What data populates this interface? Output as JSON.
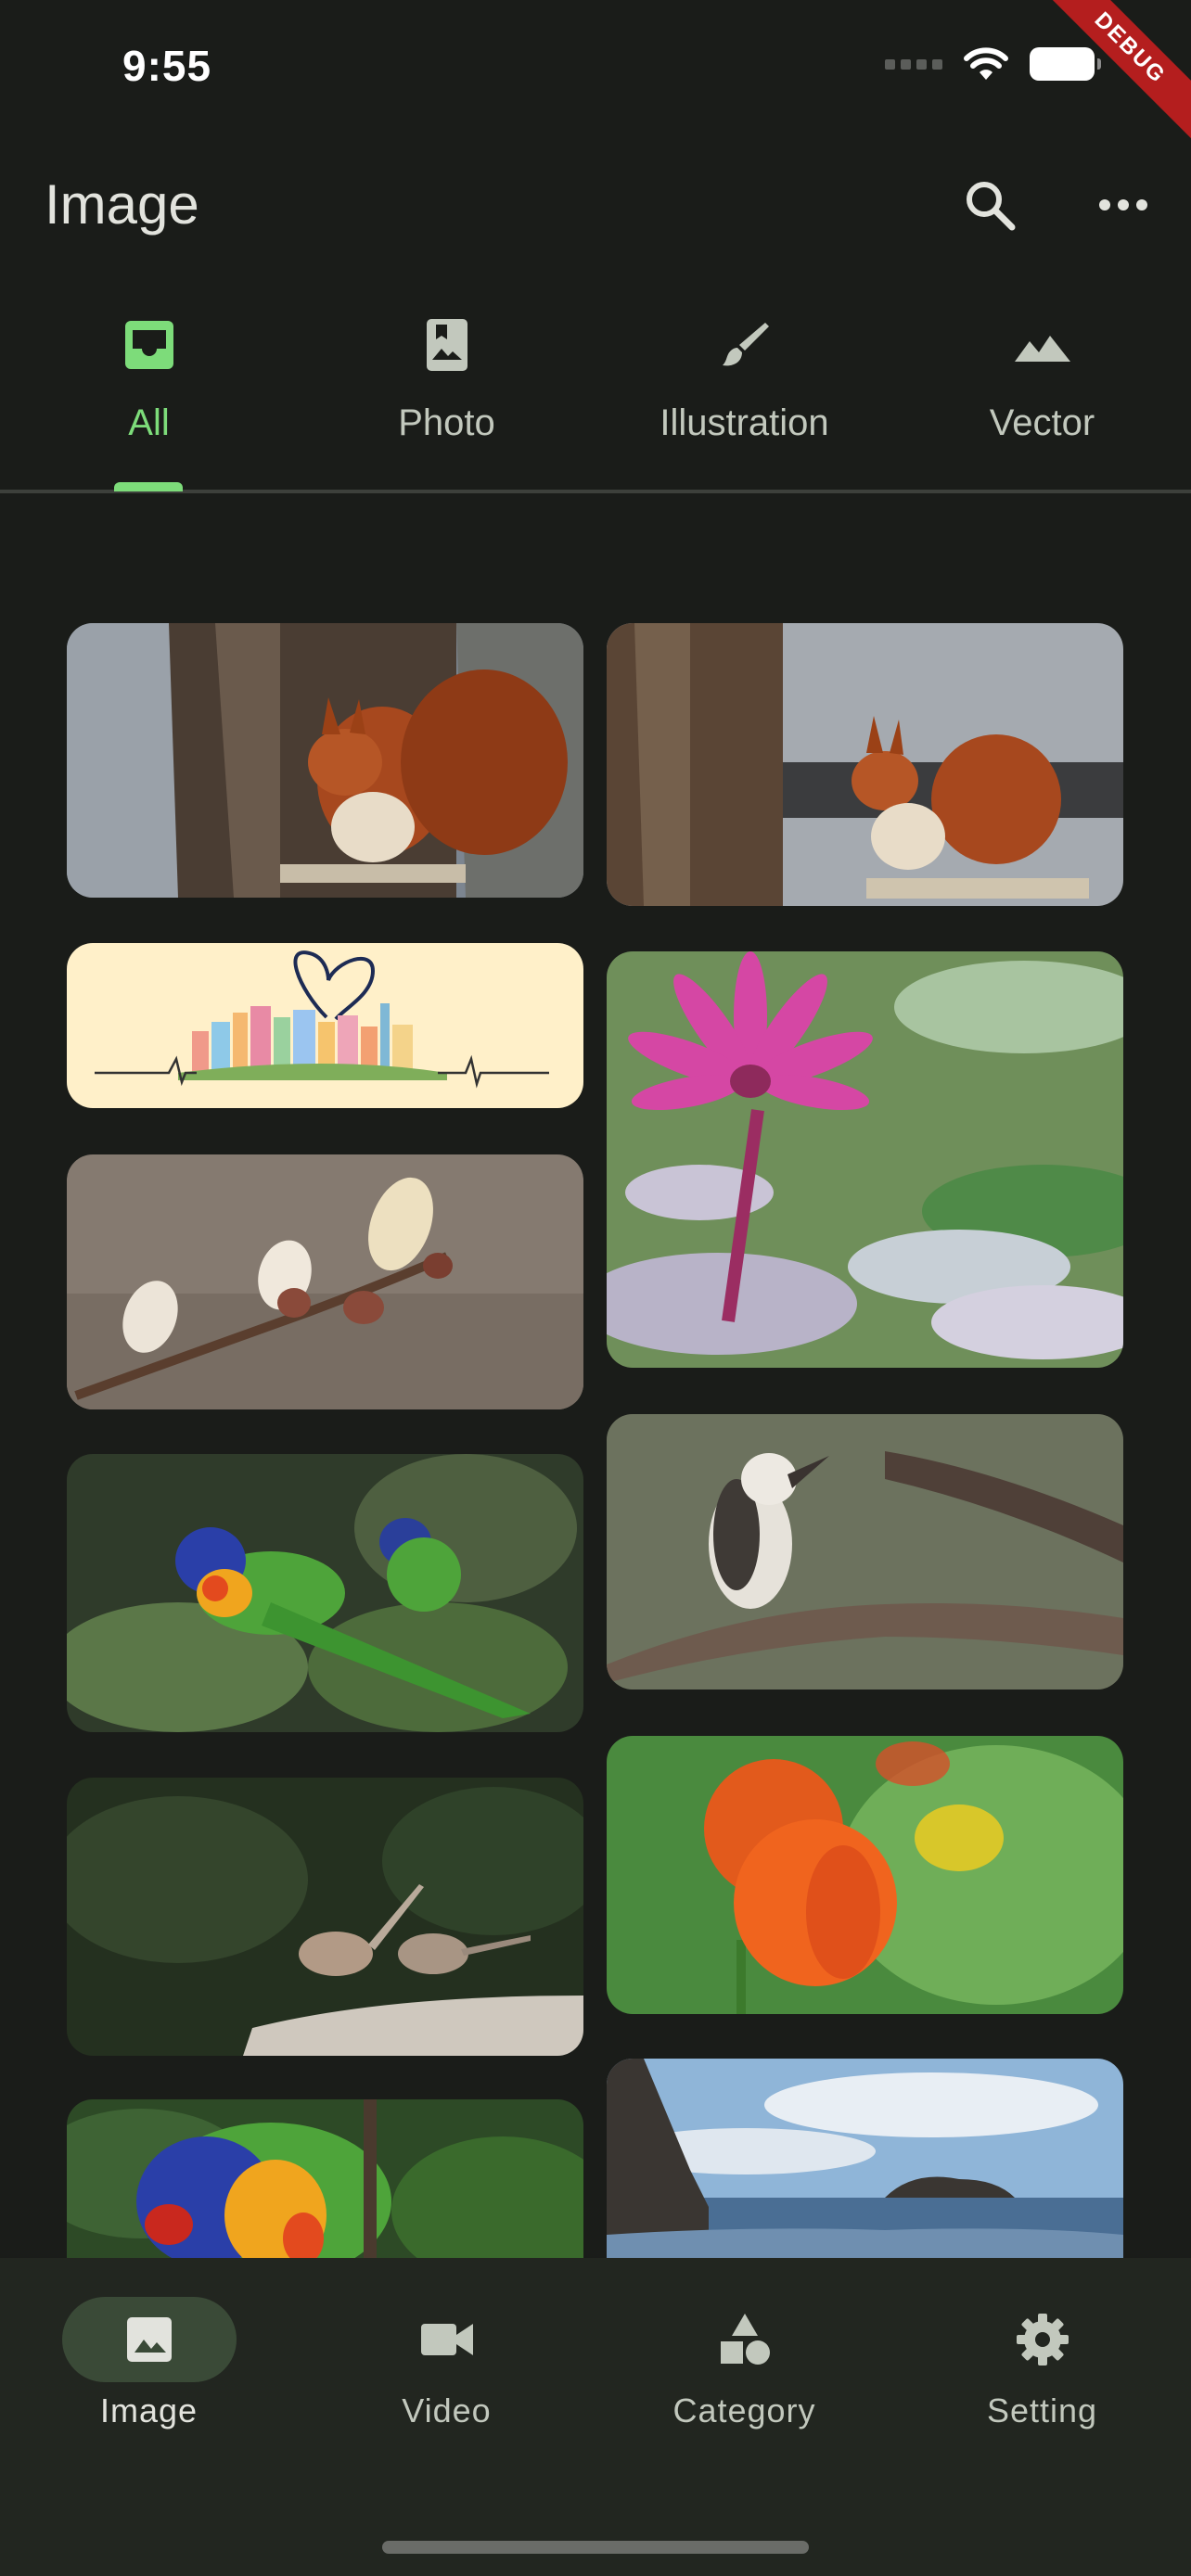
{
  "status_bar": {
    "time": "9:55"
  },
  "debug_banner": "DEBUG",
  "app_bar": {
    "title": "Image",
    "actions": [
      "search-icon",
      "more-horiz-icon"
    ]
  },
  "tabs": [
    {
      "label": "All",
      "icon": "inbox-icon",
      "active": true
    },
    {
      "label": "Photo",
      "icon": "photo-bookmark-icon",
      "active": false
    },
    {
      "label": "Illustration",
      "icon": "brush-icon",
      "active": false
    },
    {
      "label": "Vector",
      "icon": "landscape-icon",
      "active": false
    }
  ],
  "images": [
    {
      "subject": "red squirrel on stump, tree bark"
    },
    {
      "subject": "red squirrel beside tree trunk"
    },
    {
      "subject": "city skyline heart heartbeat illustration"
    },
    {
      "subject": "pink water lily over lily pads"
    },
    {
      "subject": "willow catkins on branch"
    },
    {
      "subject": "kookaburra on branch"
    },
    {
      "subject": "rainbow lorikeets in leaves"
    },
    {
      "subject": "orange tulips"
    },
    {
      "subject": "two small birds on log"
    },
    {
      "subject": "rocky coastline seascape"
    },
    {
      "subject": "rainbow lorikeet close-up"
    }
  ],
  "colors": {
    "background": "#1a1c19",
    "accent": "#7ddc7a",
    "nav_background": "#222620",
    "nav_active_pill": "#3a4a37"
  },
  "bottom_nav": [
    {
      "label": "Image",
      "icon": "image-icon",
      "active": true
    },
    {
      "label": "Video",
      "icon": "videocam-icon",
      "active": false
    },
    {
      "label": "Category",
      "icon": "category-icon",
      "active": false
    },
    {
      "label": "Setting",
      "icon": "settings-gear-icon",
      "active": false
    }
  ]
}
